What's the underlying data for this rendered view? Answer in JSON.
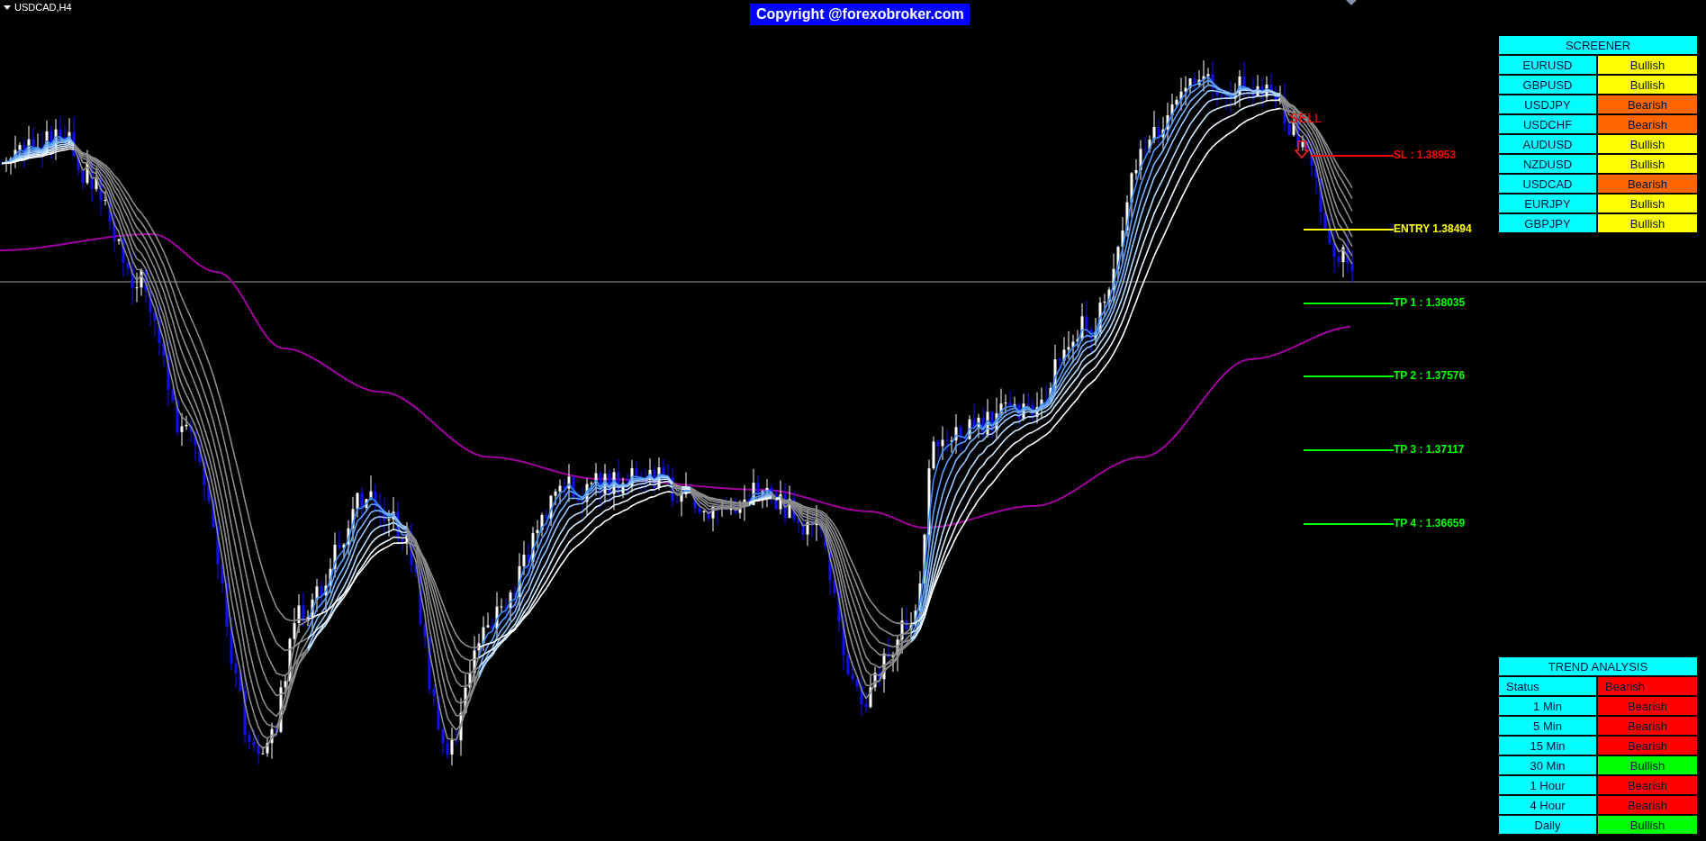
{
  "chart": {
    "symbol": "USDCAD,H4",
    "copyright": "Copyright @forexobroker.com",
    "signal": "SELL",
    "levels": [
      {
        "kind": "sl",
        "label": "SL : 1.38953",
        "color": "#ff0000"
      },
      {
        "kind": "entry",
        "label": "ENTRY 1.38494",
        "color": "#ffff00"
      },
      {
        "kind": "tp",
        "label": "TP 1 : 1.38035",
        "color": "#00ff00"
      },
      {
        "kind": "tp",
        "label": "TP 2 : 1.37576",
        "color": "#00ff00"
      },
      {
        "kind": "tp",
        "label": "TP 3 : 1.37117",
        "color": "#00ff00"
      },
      {
        "kind": "tp",
        "label": "TP 4 : 1.36659",
        "color": "#00ff00"
      }
    ]
  },
  "screener": {
    "title": "SCREENER",
    "rows": [
      {
        "pair": "EURUSD",
        "trend": "Bullish",
        "color": "#ffff00"
      },
      {
        "pair": "GBPUSD",
        "trend": "Bullish",
        "color": "#ffff00"
      },
      {
        "pair": "USDJPY",
        "trend": "Bearish",
        "color": "#ff6600"
      },
      {
        "pair": "USDCHF",
        "trend": "Bearish",
        "color": "#ff6600"
      },
      {
        "pair": "AUDUSD",
        "trend": "Bullish",
        "color": "#ffff00"
      },
      {
        "pair": "NZDUSD",
        "trend": "Bullish",
        "color": "#ffff00"
      },
      {
        "pair": "USDCAD",
        "trend": "Bearish",
        "color": "#ff6600"
      },
      {
        "pair": "EURJPY",
        "trend": "Bullish",
        "color": "#ffff00"
      },
      {
        "pair": "GBPJPY",
        "trend": "Bullish",
        "color": "#ffff00"
      }
    ]
  },
  "trend_analysis": {
    "title": "TREND ANALYSIS",
    "status": {
      "label": "Status",
      "value": "Bearish",
      "color": "#ff0000"
    },
    "rows": [
      {
        "timeframe": "1 Min",
        "trend": "Bearish",
        "color": "#ff0000"
      },
      {
        "timeframe": "5 Min",
        "trend": "Bearish",
        "color": "#ff0000"
      },
      {
        "timeframe": "15 Min",
        "trend": "Bearish",
        "color": "#ff0000"
      },
      {
        "timeframe": "30 Min",
        "trend": "Bullish",
        "color": "#00ff00"
      },
      {
        "timeframe": "1 Hour",
        "trend": "Bearish",
        "color": "#ff0000"
      },
      {
        "timeframe": "4 Hour",
        "trend": "Bearish",
        "color": "#ff0000"
      },
      {
        "timeframe": "Daily",
        "trend": "Bullish",
        "color": "#00ff00"
      }
    ]
  }
}
